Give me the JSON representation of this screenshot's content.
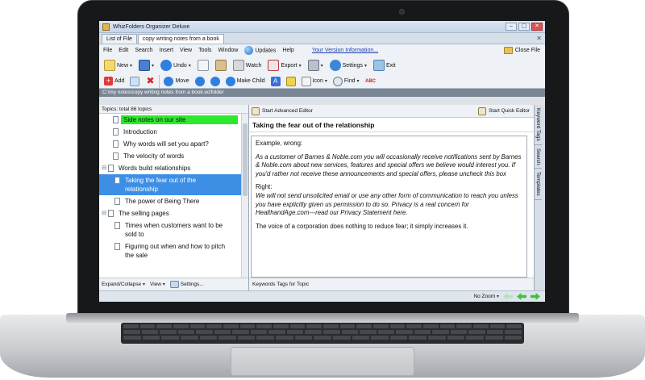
{
  "window": {
    "title": "WhizFolders Organizer Deluxe",
    "min": "–",
    "max": "▢",
    "close": "✕"
  },
  "tabs": [
    {
      "label": "List of File"
    },
    {
      "label": "copy writing notes from a book"
    }
  ],
  "menu": {
    "items": [
      "File",
      "Edit",
      "Search",
      "Insert",
      "View",
      "Tools",
      "Window"
    ],
    "updates": "Updates",
    "help": "Help",
    "version_link": "Your Version Information...",
    "close_file": "Close File"
  },
  "toolbar": {
    "new": "New",
    "undo": "Undo",
    "watch": "Watch",
    "export": "Export",
    "settings": "Settings",
    "exit": "Exit",
    "add": "Add",
    "move": "Move",
    "make_child": "Make Child",
    "icon": "Icon",
    "find": "Find"
  },
  "path": "C:\\my notes\\copy writing notes from a book.wzfolder",
  "topics": {
    "header": "Topics: total 86 topics",
    "items": [
      "Side notes on our site",
      "Introduction",
      "Why words will set you apart?",
      "The velocity of words",
      "Words build relationships",
      "Taking the fear out of the relationship",
      "The power of Being There",
      "The selling pages",
      "Times when customers want to be sold to",
      "Figuring out when and how to pitch the sale"
    ],
    "expand_collapse": "Expand/Collapse",
    "view": "View",
    "settings": "Settings..."
  },
  "editor": {
    "advanced": "Start Advanced Editor",
    "quick": "Start Quick Editor",
    "title": "Taking the fear out of the relationship",
    "body": {
      "p1": "Example, wrong:",
      "p2": "As a customer of Barnes & Noble.com you will occasionally receive notifications sent by Barnes & Noble.com about new services, features and special offers we believe would interest you. If you'd rather not receive these announcements and special offers, please uncheck this box",
      "p3": "Right:",
      "p4": "We will not send unsolicited email or use any other form of communication to reach you unless you have explicitly given us permission to do so. Privacy is a real concern for HealthandAge.com---read our Privacy Statement here.",
      "p5": "The voice of a corporation does nothing to reduce fear; it simply increases it."
    },
    "footer": "Keywords Tags for Topic",
    "side_tabs": [
      "Keyword Tags",
      "Search",
      "Templates"
    ]
  },
  "status": {
    "zoom": "No Zoom"
  }
}
